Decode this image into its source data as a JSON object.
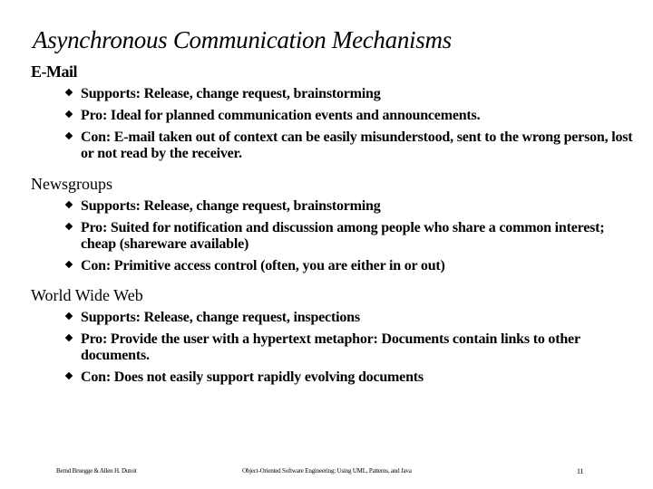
{
  "slide": {
    "title": "Asynchronous Communication Mechanisms",
    "sections": [
      {
        "heading": "E-Mail",
        "bullets": [
          "Supports: Release, change request, brainstorming",
          "Pro: Ideal for planned communication events and announcements.",
          "Con: E-mail taken out of context can be easily misunderstood, sent to the wrong person, lost or not read by the receiver."
        ]
      },
      {
        "heading": "Newsgroups",
        "bullets": [
          "Supports: Release, change request, brainstorming",
          "Pro: Suited for notification and discussion among people who share a common interest; cheap (shareware available)",
          "Con: Primitive access control (often, you are either in or out)"
        ]
      },
      {
        "heading": "World Wide Web",
        "bullets": [
          "Supports: Release, change request, inspections",
          "Pro: Provide the user with a hypertext metaphor: Documents contain links to other documents.",
          "Con: Does not easily support rapidly evolving documents"
        ]
      }
    ],
    "bullet_icon": "diamond-bullet-icon"
  },
  "footer": {
    "authors": "Bernd Bruegge & Allen H. Dutoit",
    "book_title": "Object-Oriented Software Engineering: Using UML, Patterns, and Java",
    "page_number": "11"
  }
}
